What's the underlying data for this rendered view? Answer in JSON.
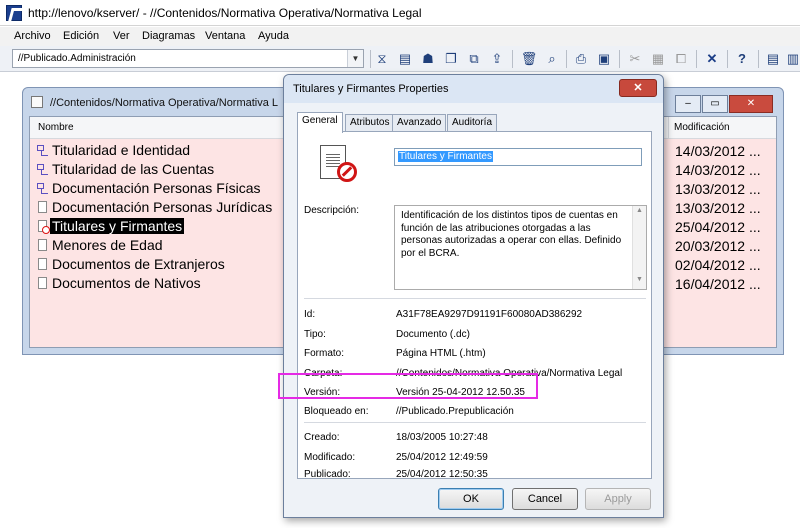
{
  "window": {
    "title": "http://lenovo/kserver/ - //Contenidos/Normativa Operativa/Normativa Legal"
  },
  "menu": [
    "Archivo",
    "Edición",
    "Ver",
    "Diagramas",
    "Ventana",
    "Ayuda"
  ],
  "toolbar": {
    "context_value": "//Publicado.Administración",
    "icons": [
      "filter-icon",
      "properties-icon",
      "user-icon",
      "window-icon",
      "copy-window-icon",
      "upload-icon",
      "delete-icon",
      "search-icon",
      "print-icon",
      "preview-icon",
      "cut-icon",
      "paste-icon",
      "copy-icon",
      "close-x-icon",
      "help-icon",
      "document-icon",
      "document-alt-icon"
    ]
  },
  "background_window": {
    "title": "//Contenidos/Normativa Operativa/Normativa L",
    "columns": {
      "name": "Nombre",
      "modified": "Modificación"
    },
    "rows": [
      {
        "icon": "tree-icon",
        "name": "Titularidad e Identidad",
        "date": "14/03/2012 ..."
      },
      {
        "icon": "tree-icon",
        "name": "Titularidad de las Cuentas",
        "date": "14/03/2012 ..."
      },
      {
        "icon": "tree-icon",
        "name": "Documentación Personas Físicas",
        "date": "13/03/2012 ..."
      },
      {
        "icon": "document-icon",
        "name": "Documentación Personas Jurídicas",
        "date": "13/03/2012 ..."
      },
      {
        "icon": "locked-document-icon",
        "name": "Titulares y Firmantes",
        "date": "25/04/2012 ...",
        "selected": true
      },
      {
        "icon": "document-icon",
        "name": "Menores de Edad",
        "date": "20/03/2012 ..."
      },
      {
        "icon": "document-icon",
        "name": "Documentos de Extranjeros",
        "date": "02/04/2012 ..."
      },
      {
        "icon": "document-icon",
        "name": "Documentos de Nativos",
        "date": "16/04/2012 ..."
      }
    ]
  },
  "dialog": {
    "title": "Titulares y Firmantes Properties",
    "close_glyph": "✕",
    "tabs": [
      "General",
      "Atributos",
      "Avanzado",
      "Auditoría"
    ],
    "active_tab": "General",
    "name_value": "Titulares y Firmantes",
    "description_label": "Descripción:",
    "description": "Identificación de los distintos tipos de cuentas en función de las atribuciones otorgadas a las personas autorizadas a operar con ellas. Definido por el BCRA.",
    "props_group1": [
      {
        "label": "Id:",
        "value": "A31F78EA9297D91191F60080AD386292"
      },
      {
        "label": "Tipo:",
        "value": "Documento (.dc)"
      },
      {
        "label": "Formato:",
        "value": "Página HTML (.htm)"
      },
      {
        "label": "Carpeta:",
        "value": "//Contenidos/Normativa Operativa/Normativa Legal"
      },
      {
        "label": "Versión:",
        "value": "Versión 25-04-2012 12.50.35"
      },
      {
        "label": "Bloqueado en:",
        "value": "//Publicado.Prepublicación"
      }
    ],
    "props_group2": [
      {
        "label": "Creado:",
        "value": "18/03/2005 10:27:48"
      },
      {
        "label": "Modificado:",
        "value": "25/04/2012 12:49:59"
      },
      {
        "label": "Publicado:",
        "value": "25/04/2012 12:50:35"
      }
    ],
    "buttons": {
      "ok": "OK",
      "cancel": "Cancel",
      "apply": "Apply"
    }
  },
  "colors": {
    "highlight": "#e52ae5",
    "list_background": "#fde4e4",
    "selection": "#000000"
  }
}
